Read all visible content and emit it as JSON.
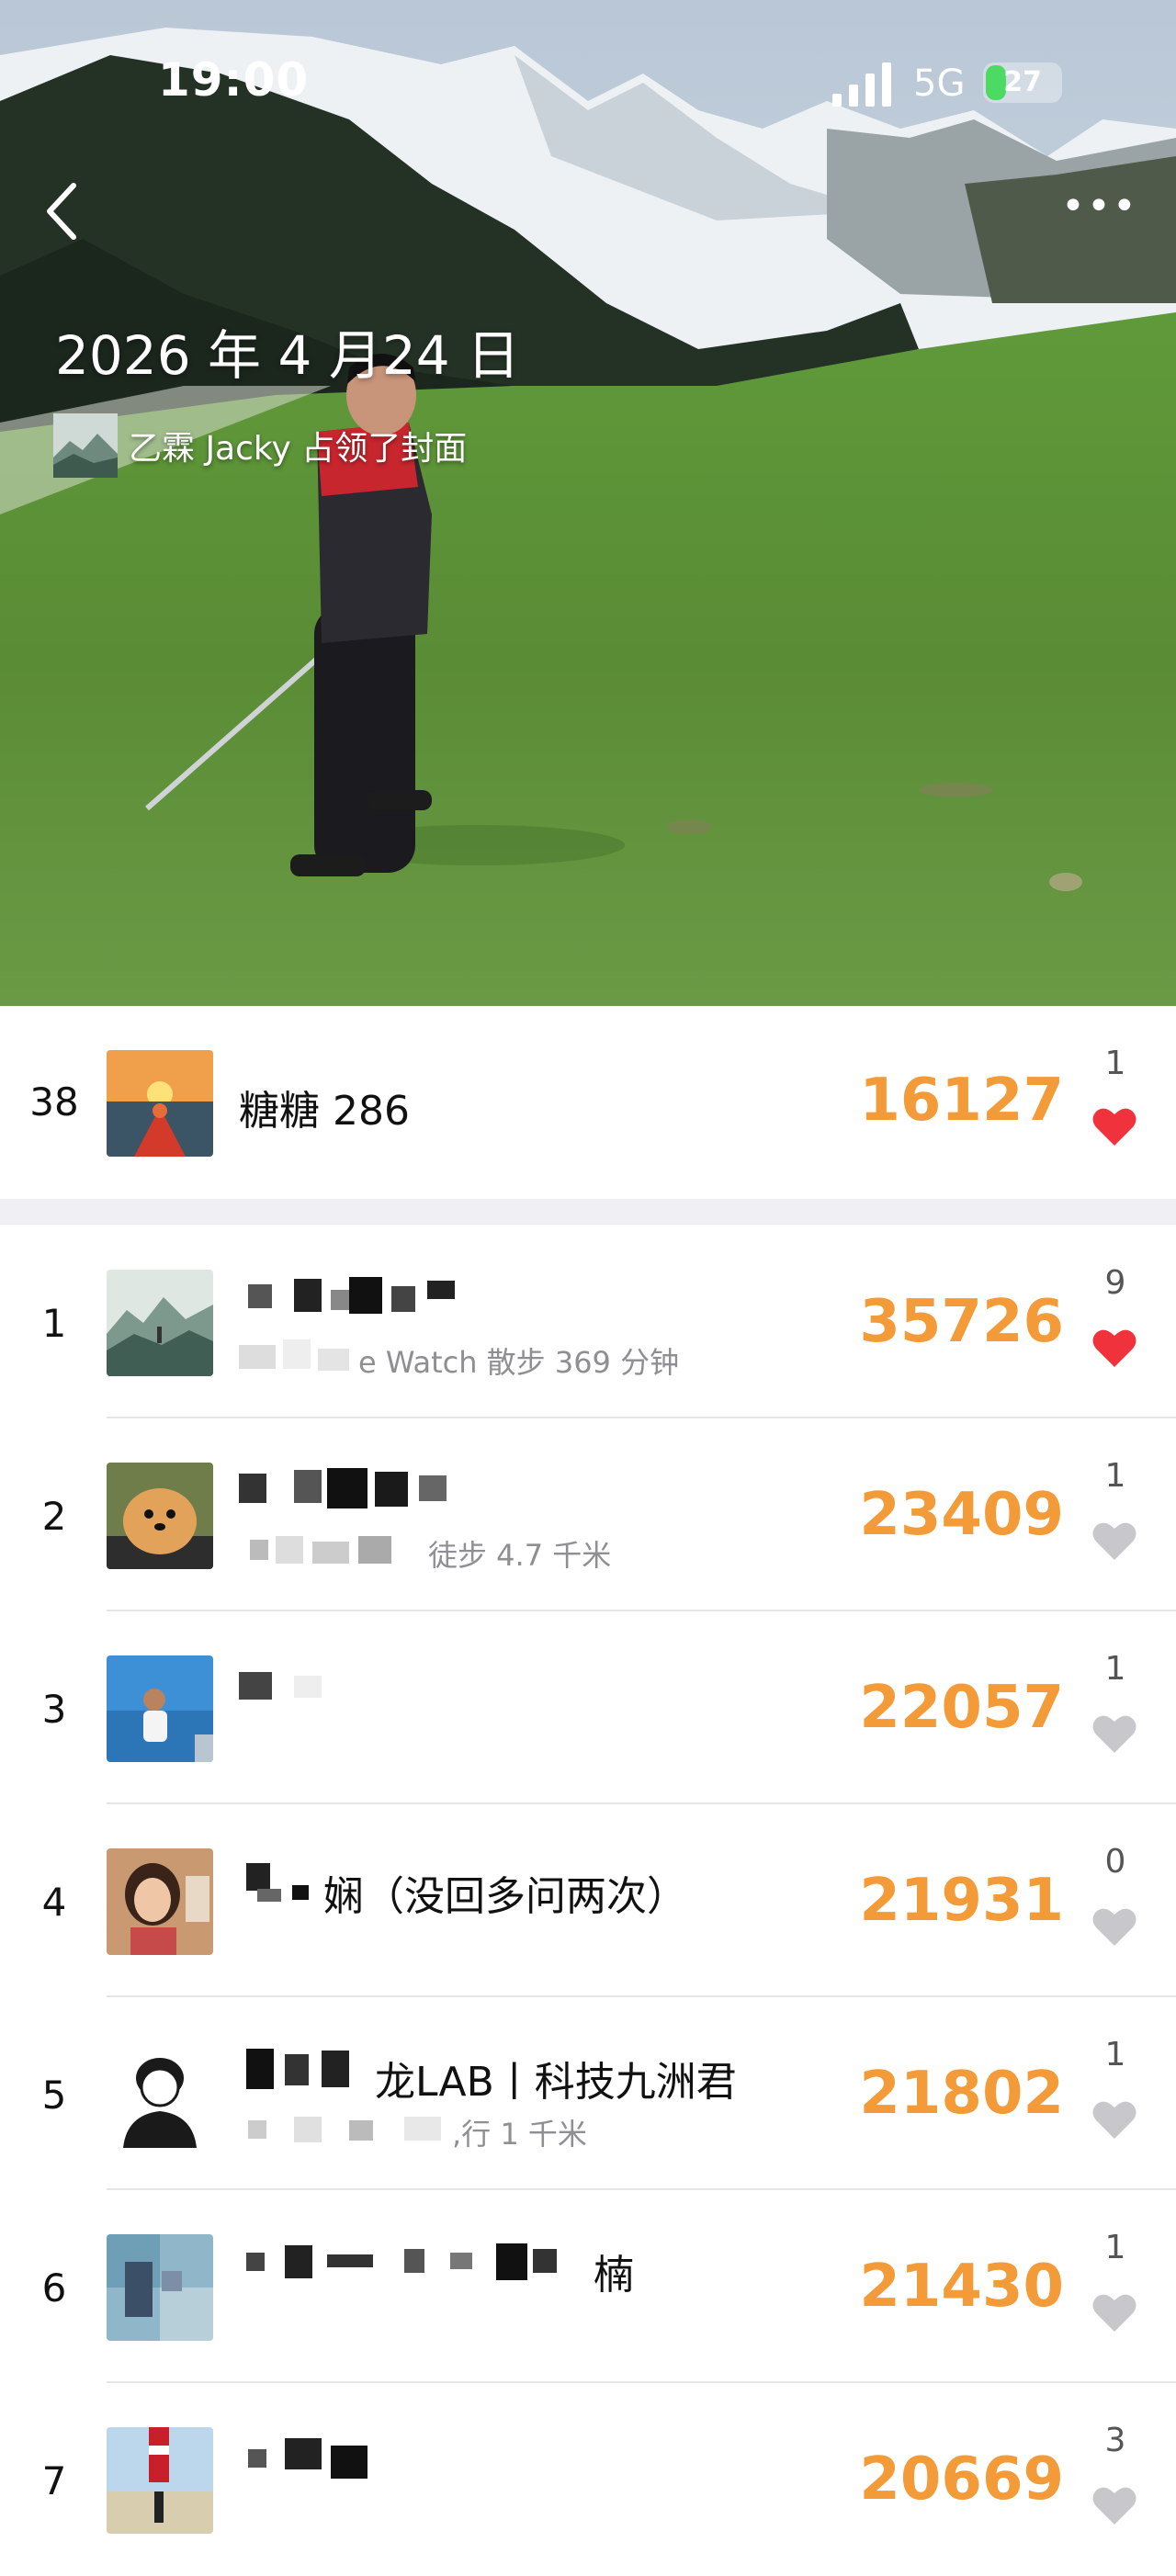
{
  "status_bar": {
    "time": "19:00",
    "network": "5G",
    "battery": "27",
    "battery_level": 0.27
  },
  "cover": {
    "date": "2026 年 4 月24 日",
    "owner_text": "乙霖 Jacky 占领了封面"
  },
  "self": {
    "rank": "38",
    "name": "糖糖 286",
    "steps": "16127",
    "likes": "1",
    "liked": true
  },
  "colors": {
    "accent": "#f29b38",
    "heart_active": "#f0323c",
    "heart_inactive": "#c7c7cc"
  },
  "icons": {
    "back": "chevron-left-icon",
    "more": "more-dots-icon",
    "heart": "heart-icon"
  },
  "ranking": [
    {
      "rank": "1",
      "name": "",
      "sub": "e Watch   散步 369 分钟",
      "steps": "35726",
      "likes": "9",
      "liked": true
    },
    {
      "rank": "2",
      "name": "",
      "sub": "徒步 4.7 千米",
      "steps": "23409",
      "likes": "1",
      "liked": false
    },
    {
      "rank": "3",
      "name": "",
      "sub": "",
      "steps": "22057",
      "likes": "1",
      "liked": false
    },
    {
      "rank": "4",
      "name": "娴（没回多问两次）",
      "sub": "",
      "steps": "21931",
      "likes": "0",
      "liked": false
    },
    {
      "rank": "5",
      "name": "龙LAB丨科技九洲君",
      "sub": ",行 1 千米",
      "steps": "21802",
      "likes": "1",
      "liked": false
    },
    {
      "rank": "6",
      "name": "楠",
      "sub": "",
      "steps": "21430",
      "likes": "1",
      "liked": false
    },
    {
      "rank": "7",
      "name": "",
      "sub": "",
      "steps": "20669",
      "likes": "3",
      "liked": false
    }
  ]
}
